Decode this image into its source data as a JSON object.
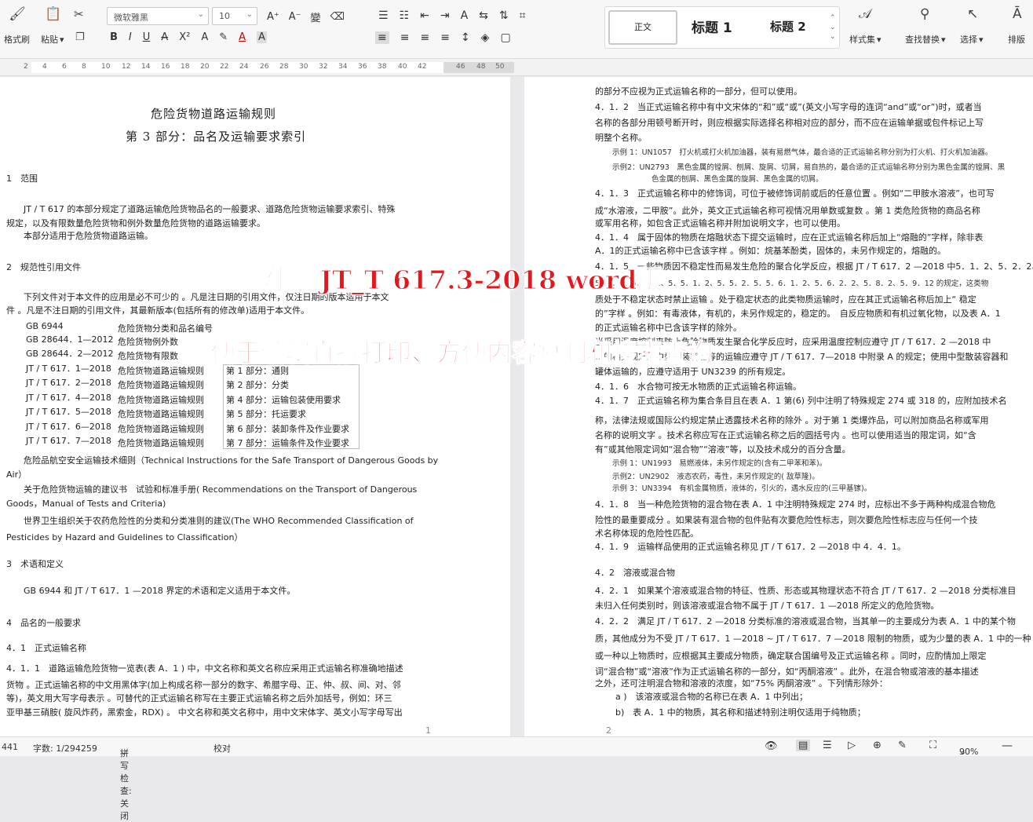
{
  "toolbar": {
    "format_painter": "格式刷",
    "paste": "粘贴",
    "font_name": "微软雅黑",
    "font_size": "10",
    "styles": {
      "normal": "正文",
      "h1": "标题 1",
      "h2": "标题 2"
    },
    "style_set": "样式集",
    "find_replace": "查找替换",
    "select": "选择",
    "layout": "排版"
  },
  "ruler_marks": [
    "2",
    "4",
    "6",
    "8",
    "10",
    "12",
    "14",
    "16",
    "18",
    "20",
    "22",
    "24",
    "26",
    "28",
    "30",
    "32",
    "34",
    "36",
    "38",
    "40",
    "42",
    "46",
    "48",
    "50"
  ],
  "page1": {
    "title1": "危险货物道路运输规则",
    "title2": "第 3 部分：品名及运输要求索引",
    "s1": "1　范围",
    "p1a": "JT / T 617 的本部分规定了道路运输危险货物品名的一般要求、道路危险货物运输要求索引、特殊",
    "p1b": "规定，以及有限数量危险货物和例外数量危险货物的道路运输要求。",
    "p1c": "本部分适用于危险货物道路运输。",
    "s2": "2　规范性引用文件",
    "p2a": "下列文件对于本文件的应用是必不可少的 。凡是注日期的引用文件，仅注日期的版本适用于本文",
    "p2b": "件 。凡是不注日期的引用文件，其最新版本(包括所有的修改单)适用于本文件。",
    "refs": [
      {
        "code": "GB 6944",
        "name": "危险货物分类和品名编号",
        "part": ""
      },
      {
        "code": "GB 28644．1—2012",
        "name": "危险货物例外数",
        "part": ""
      },
      {
        "code": "GB 28644．2—2012",
        "name": "危险货物有限数",
        "part": ""
      },
      {
        "code": "JT / T 617．1—2018",
        "name": "危险货物道路运输规则",
        "part": "第 1 部分：通则"
      },
      {
        "code": "JT / T 617．2—2018",
        "name": "危险货物道路运输规则",
        "part": "第 2 部分：分类"
      },
      {
        "code": "JT / T 617．4—2018",
        "name": "危险货物道路运输规则",
        "part": "第 4 部分：运输包装使用要求"
      },
      {
        "code": "JT / T 617．5—2018",
        "name": "危险货物道路运输规则",
        "part": "第 5 部分：托运要求"
      },
      {
        "code": "JT / T 617．6—2018",
        "name": "危险货物道路运输规则",
        "part": "第 6 部分：装卸条件及作业要求"
      },
      {
        "code": "JT / T 617．7—2018",
        "name": "危险货物道路运输规则",
        "part": "第 7 部分：运输条件及作业要求"
      }
    ],
    "ref_a1": "危险品航空安全运输技术细则（Technical Instructions for the Safe Transport of Dangerous Goods by",
    "ref_a2": "Air）",
    "ref_b1": "关于危险货物运输的建议书　试验和标准手册( Recommendations on the Transport of Dangerous",
    "ref_b2": "Goods，Manual of Tests and Criteria)",
    "ref_c1": "世界卫生组织关于农药危险性的分类和分类准则的建议(The WHO Recommended Classification of",
    "ref_c2": "Pesticides by Hazard and Guidelines to Classification）",
    "s3": "3　术语和定义",
    "p3": "GB 6944 和 JT / T 617．1 —2018 界定的术语和定义适用于本文件。",
    "s4": "4　品名的一般要求",
    "s41": "4．1　正式运输名称",
    "p411a": "4．1．1　道路运输危险货物一览表(表 A．1 ) 中，中文名称和英文名称应采用正式运输名称准确地描述",
    "p411b": "货物 。正式运输名称的中文用黑体字(加上构成名称一部分的数字、希腊字母、正、仲、叔、间、对、邻",
    "p411c": "等)，英文用大写字母表示 。可替代的正式运输名称写在主要正式运输名称之后外加括号，例如：环三",
    "p411d": "亚甲基三硝胺( 旋风炸药，黑索金，RDX) 。 中文名称和英文名称中，用中文宋体字、英文小写字母写出",
    "pageno": "1"
  },
  "page2": {
    "l01": "的部分不应视为正式运输名称的一部分，但可以使用。",
    "l02": "4．1．2　当正式运输名称中有中文宋体的“和”或“或”(英文小写字母的连词“and”或“or”)时，或者当",
    "l03": "名称的各部分用顿号断开时，则应根据实际选择名称相对应的部分，而不应在运输单据或包件标记上写",
    "l04": "明整个名称。",
    "ex1": "示例 1：UN1057　打火机或打火机加油器，装有易燃气体，最合适的正式运输名称分别为打火机、打火机加油器。",
    "ex2a": "示例2：UN2793　黑色金属的镗屑、刨屑、旋屑、切屑，易自热的，最合适的正式运输名称分别为黑色金属的镗屑、黑",
    "ex2b": "色金属的刨屑、黑色金属的旋屑、黑色金属的切屑。",
    "l05": "4．1．3　正式运输名称中的修饰词，可位于被修饰词前或后的任意位置 。例如“二甲胺水溶液”，也可写",
    "l06": "成“水溶液，二甲胺”。此外，英文正式运输名称可视情况用单数或复数 。第 1 类危险货物的商品名称",
    "l07": "或军用名称，如包含正式运输名称并附加说明文字，也可以使用。",
    "l08": "4．1．4　属于固体的物质在熔融状态下提交运输时，应在正式运输名称后加上“熔融的”字样，除非表",
    "l09": "A．1的正式运输名称中已含该字样 。例如：烷基苯酚类，固体的，未另作规定的，熔融的。",
    "l10": "4．1．5　一些物质因不稳定性而易发生危险的聚合化学反应，根据 JT / T 617．2 —2018 中5．1．2、5．2．2、",
    "l11": "5．3．4、5．4．1、5．5．1．2、5．5．2．5．5．6．1．2、5．6．2．2、5．8．2、5．9．12 的规定，这类物",
    "l12": "质处于不稳定状态时禁止运输 。处于稳定状态的此类物质运输时，应在其正式运输名称后加上“ 稳定",
    "l13": "的”字样 。例如：有毒液体，有机的，未另作规定的，稳定的。　自反应物质和有机过氧化物，以及表 A．1",
    "l14": "的正式运输名称中已含该字样的除外。",
    "l15": "当采用温度控制来防止危险物质发生聚合化学反应时，应采用温度控制应遵守 JT / T 617．2 —2018 中",
    "l16": "…的相关规定。中型散装容器等的运输应遵守 JT / T 617．7—2018 中附录 A 的规定；使用中型散装容器和",
    "l17": "罐体运输的，应遵守适用于 UN3239 的所有规定。",
    "l18": "4．1．6　水合物可按无水物质的正式运输名称运输。",
    "l19": "4．1．7　正式运输名称为集合条目且在表 A．1 第(6) 列中注明了特殊规定 274 或 318 的，应附加技术名",
    "l20": "称，法律法规或国际公约规定禁止透露技术名称的除外 。对于第 1 类爆炸品，可以附加商品名称或军用",
    "l21": "名称的说明文字 。技术名称应写在正式运输名称之后的圆括号内 。也可以使用适当的限定词，如“含",
    "l22": "有”或其他限定词如“混合物”“溶液”等，以及技术成分的百分含量。",
    "ex3": "示例 1：UN1993　易燃液体，未另作规定的(含有二甲苯和苯)。",
    "ex4": "示例2：UN2902　液态农药，毒性，未另作规定的( 敌草隆)。",
    "ex5": "示例 3：UN3394　有机金属物质，液体的，引火的，遇水反应的(三甲基镓)。",
    "l23": "4．1．8　当一种危险货物的混合物在表 A．1 中注明特殊规定 274 时，应标出不多于两种构成混合物危",
    "l24": "险性的最重要成分 。如果装有混合物的包件贴有次要危险性标志，则次要危险性标志应与任何一个技",
    "l25": "术名称体现的危险性匹配。",
    "l26": "4．1．9　运输样品使用的正式运输名称见 JT / T 617．2 —2018 中 4．4．1。",
    "s42": "4．2　溶液或混合物",
    "l27": "4．2．1　如果某个溶液或混合物的特征、性质、形态或其物理状态不符合 JT / T 617．2 —2018 分类标准目",
    "l28": "未归入任何类别时，则该溶液或混合物不属于 JT / T 617．1 —2018 所定义的危险货物。",
    "l29": "4．2．2　满足 JT / T 617．2 —2018 分类标准的溶液或混合物，当其单一的主要成分为表 A．1 中的某个物",
    "l30": "质，其他成分为不受 JT / T 617．1 —2018 ~ JT / T 617．7 —2018 限制的物质，或为少量的表 A．1 中的一种",
    "l31": "或一种以上物质时，应根据其主要成分物质，确定联合国编号及正式运输名称 。同时，应酌情加上限定",
    "l32": "词“混合物”或“溶液”作为正式运输名称的一部分，如“丙酮溶液” 。此外，在混合物或溶液的基本描述",
    "l33": "之外，还可注明混合物和溶液的浓度，如“75% 丙酮溶液” 。下列情形除外：",
    "l34": "a )　该溶液或混合物的名称已在表 A．1 中列出；",
    "l35": "b)　表 A．1 中的物质，其名称和描述特别注明仅适用于纯物质；",
    "pageno": "2"
  },
  "overlay": {
    "line1": "附赠 JT_T 617.3-2018 word版",
    "line2": "便于编辑直接打印、方便内容复制和搜索查询"
  },
  "status": {
    "page_cut": "441",
    "words": "字数: 1/294259",
    "spell": "拼写检查: 关闭",
    "proof": "校对",
    "zoom": "90%"
  }
}
